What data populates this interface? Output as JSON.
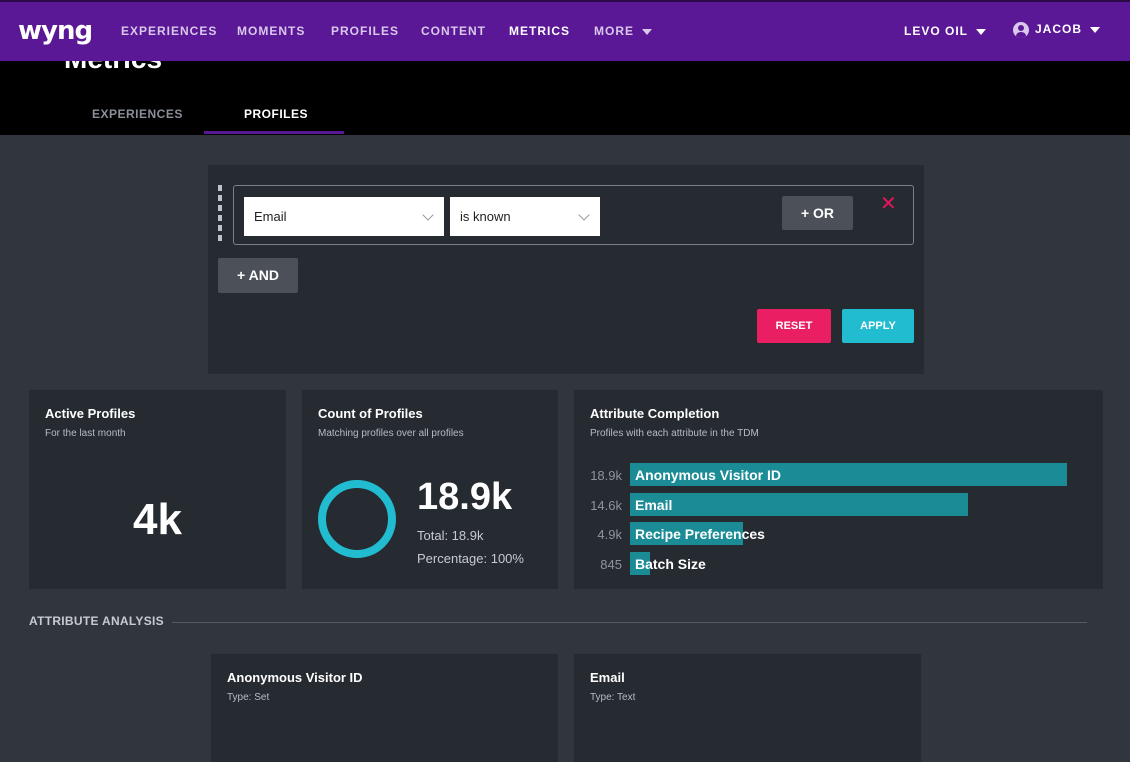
{
  "nav": {
    "logo": "wyng",
    "items": [
      "EXPERIENCES",
      "MOMENTS",
      "PROFILES",
      "CONTENT",
      "METRICS",
      "MORE"
    ],
    "account": "LEVO OIL",
    "user": "JACOB"
  },
  "header": {
    "title": "Metrics",
    "tabs": [
      "EXPERIENCES",
      "PROFILES"
    ]
  },
  "filter": {
    "field": "Email",
    "operator": "is known",
    "or_label": "+ OR",
    "and_label": "+ AND",
    "close": "✕",
    "reset_label": "RESET",
    "apply_label": "APPLY"
  },
  "active_profiles": {
    "title": "Active Profiles",
    "subtitle": "For the last month",
    "value": "4k"
  },
  "count_profiles": {
    "title": "Count of Profiles",
    "subtitle": "Matching profiles over all profiles",
    "value": "18.9k",
    "total": "Total: 18.9k",
    "percentage": "Percentage: 100%",
    "fraction": 1.0
  },
  "attribute_completion": {
    "title": "Attribute Completion",
    "subtitle": "Profiles with each attribute in the TDM",
    "rows": [
      {
        "value": "18.9k",
        "label": "Anonymous Visitor ID",
        "count": 18900
      },
      {
        "value": "14.6k",
        "label": "Email",
        "count": 14600
      },
      {
        "value": "4.9k",
        "label": "Recipe Preferences",
        "count": 4900
      },
      {
        "value": "845",
        "label": "Batch Size",
        "count": 845
      }
    ]
  },
  "analysis": {
    "section_label": "ATTRIBUTE ANALYSIS",
    "cards": [
      {
        "title": "Anonymous Visitor ID",
        "type": "Type: Set"
      },
      {
        "title": "Email",
        "type": "Type: Text"
      }
    ]
  },
  "colors": {
    "nav_bg": "#5a1896",
    "accent_teal": "#21bcd0",
    "reset_pink": "#e91e63",
    "bar_teal": "#1b8c96"
  }
}
